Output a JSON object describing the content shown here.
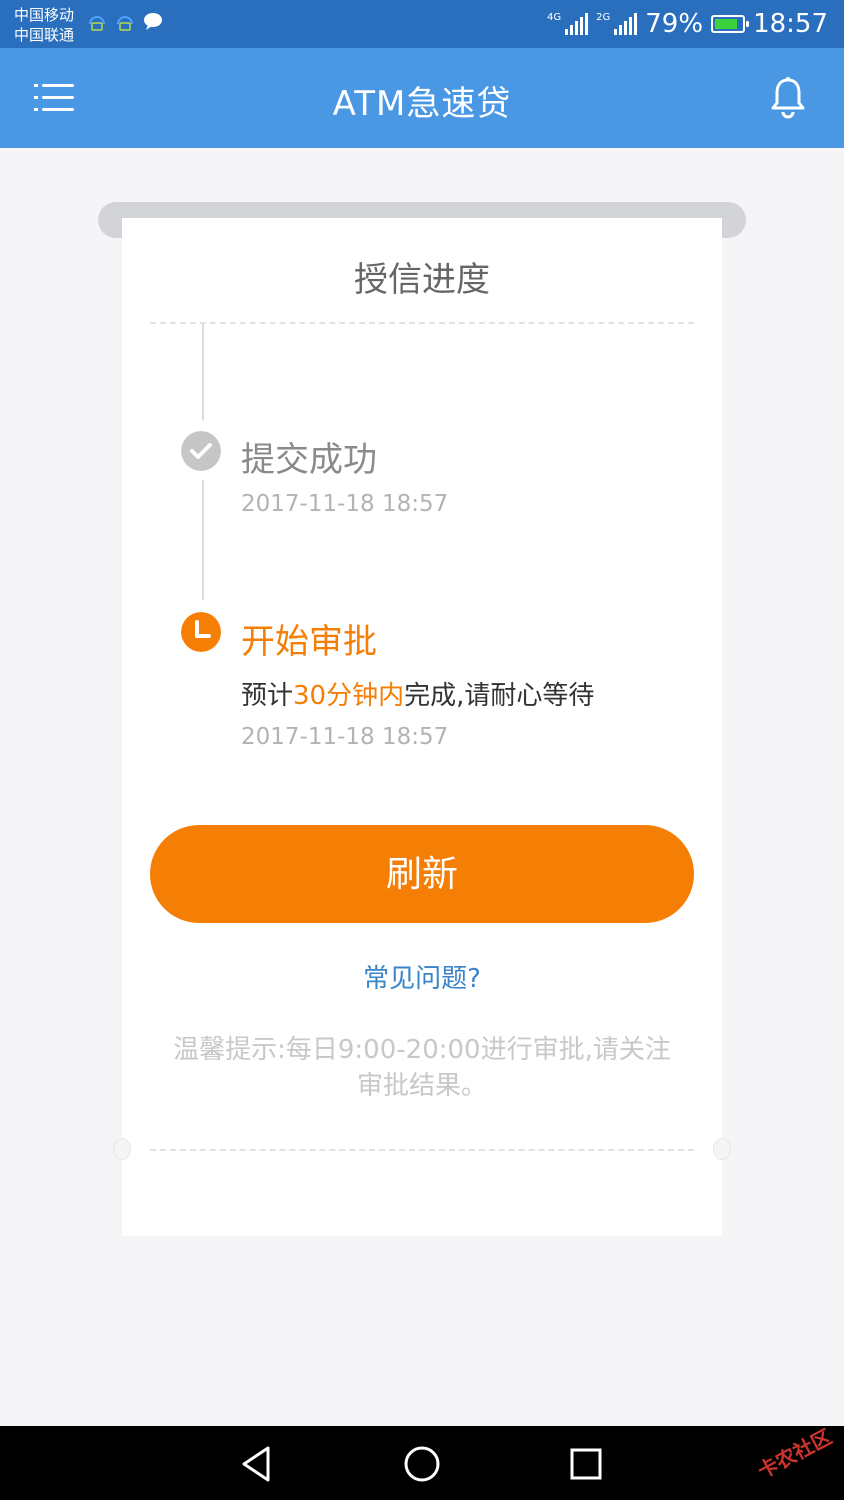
{
  "status_bar": {
    "carrier_1": "中国移动",
    "carrier_2": "中国联通",
    "net_1": "4G",
    "net_2": "2G",
    "battery": "79%",
    "time": "18:57"
  },
  "header": {
    "title": "ATM急速贷",
    "menu_icon": "menu-list-icon",
    "bell_icon": "bell-icon",
    "color": "#4a97e4"
  },
  "card": {
    "title": "授信进度",
    "steps": [
      {
        "title": "提交成功",
        "time": "2017-11-18 18:57",
        "status": "done",
        "icon": "check-circle-icon",
        "color": "#c6c6c6"
      },
      {
        "title": "开始审批",
        "desc_prefix": "预计",
        "desc_highlight": "30分钟内",
        "desc_suffix": "完成,请耐心等待",
        "time": "2017-11-18 18:57",
        "status": "current",
        "icon": "clock-icon",
        "color": "#f57e04"
      }
    ],
    "refresh_button": "刷新",
    "faq_link": "常见问题?",
    "tip_line_1": "温馨提示:每日9:00-20:00进行审批,请关注",
    "tip_line_2": "审批结果。"
  },
  "nav_bar": {
    "back_icon": "back-triangle-icon",
    "home_icon": "home-circle-icon",
    "recents_icon": "recents-square-icon",
    "watermark": "卡农社区"
  },
  "colors": {
    "accent": "#f57e04",
    "link": "#3a85c8",
    "status_bar": "#2a6fbd"
  }
}
